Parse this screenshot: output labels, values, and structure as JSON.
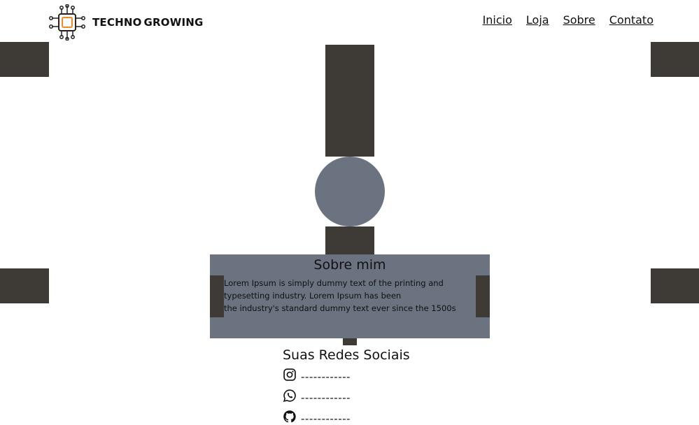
{
  "brand": {
    "name_part1": "TECHNO",
    "name_part2": "GROWING",
    "logo_icon": "circuit-chip-icon",
    "accent_color": "#f08a24"
  },
  "nav": {
    "items": [
      {
        "label": "Inicio"
      },
      {
        "label": "Loja"
      },
      {
        "label": "Sobre"
      },
      {
        "label": "Contato"
      }
    ]
  },
  "profile": {
    "avatar_color": "#6b7280"
  },
  "about": {
    "title": "Sobre mim",
    "lines": [
      "Lorem Ipsum is simply dummy text of the printing and",
      "typesetting industry. Lorem Ipsum has been",
      "the industry's standard dummy text ever since the 1500s"
    ]
  },
  "social": {
    "title": "Suas Redes Sociais",
    "items": [
      {
        "icon": "instagram-icon",
        "label": "------------"
      },
      {
        "icon": "whatsapp-icon",
        "label": "------------"
      },
      {
        "icon": "github-icon",
        "label": "------------"
      }
    ]
  },
  "colors": {
    "block": "#3e3a35",
    "panel": "#6b7280",
    "background": "#ffffff"
  }
}
